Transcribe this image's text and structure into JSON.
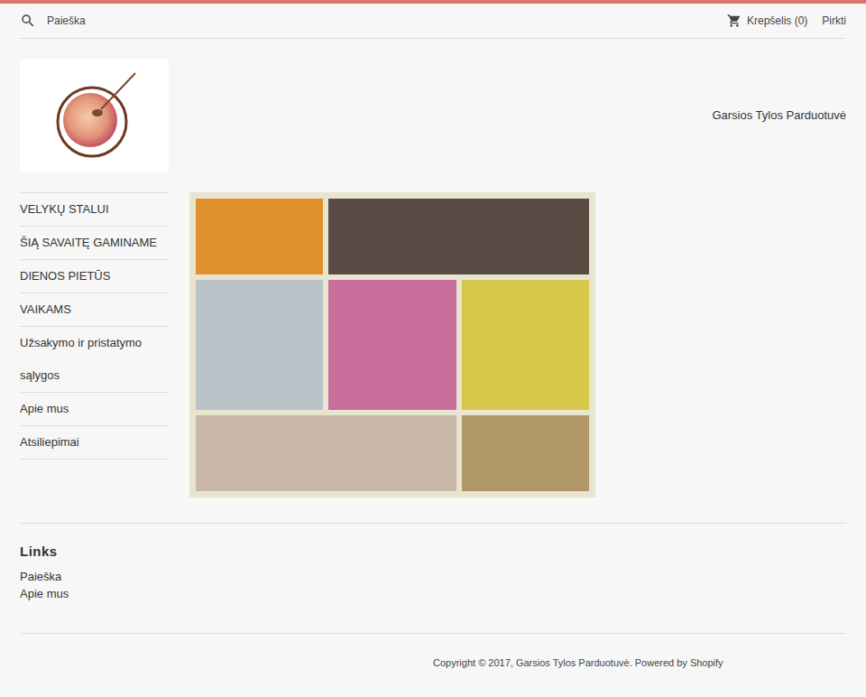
{
  "header": {
    "search": "Paieška",
    "cart": "Krepšelis (0)",
    "checkout": "Pirkti"
  },
  "site_title": "Garsios Tylos Parduotuvė",
  "nav": [
    {
      "label": "VELYKŲ STALUI"
    },
    {
      "label": "ŠIĄ SAVAITĘ GAMINAME"
    },
    {
      "label": "DIENOS PIETŪS"
    },
    {
      "label": "VAIKAMS"
    },
    {
      "label": "Užsakymo ir pristatymo sąlygos"
    },
    {
      "label": "Apie mus"
    },
    {
      "label": "Atsiliepimai"
    }
  ],
  "footer": {
    "heading": "Links",
    "links": [
      "Paieška",
      "Apie mus"
    ],
    "copyright": "Copyright © 2017, Garsios Tylos Parduotuvė. Powered by Shopify"
  }
}
